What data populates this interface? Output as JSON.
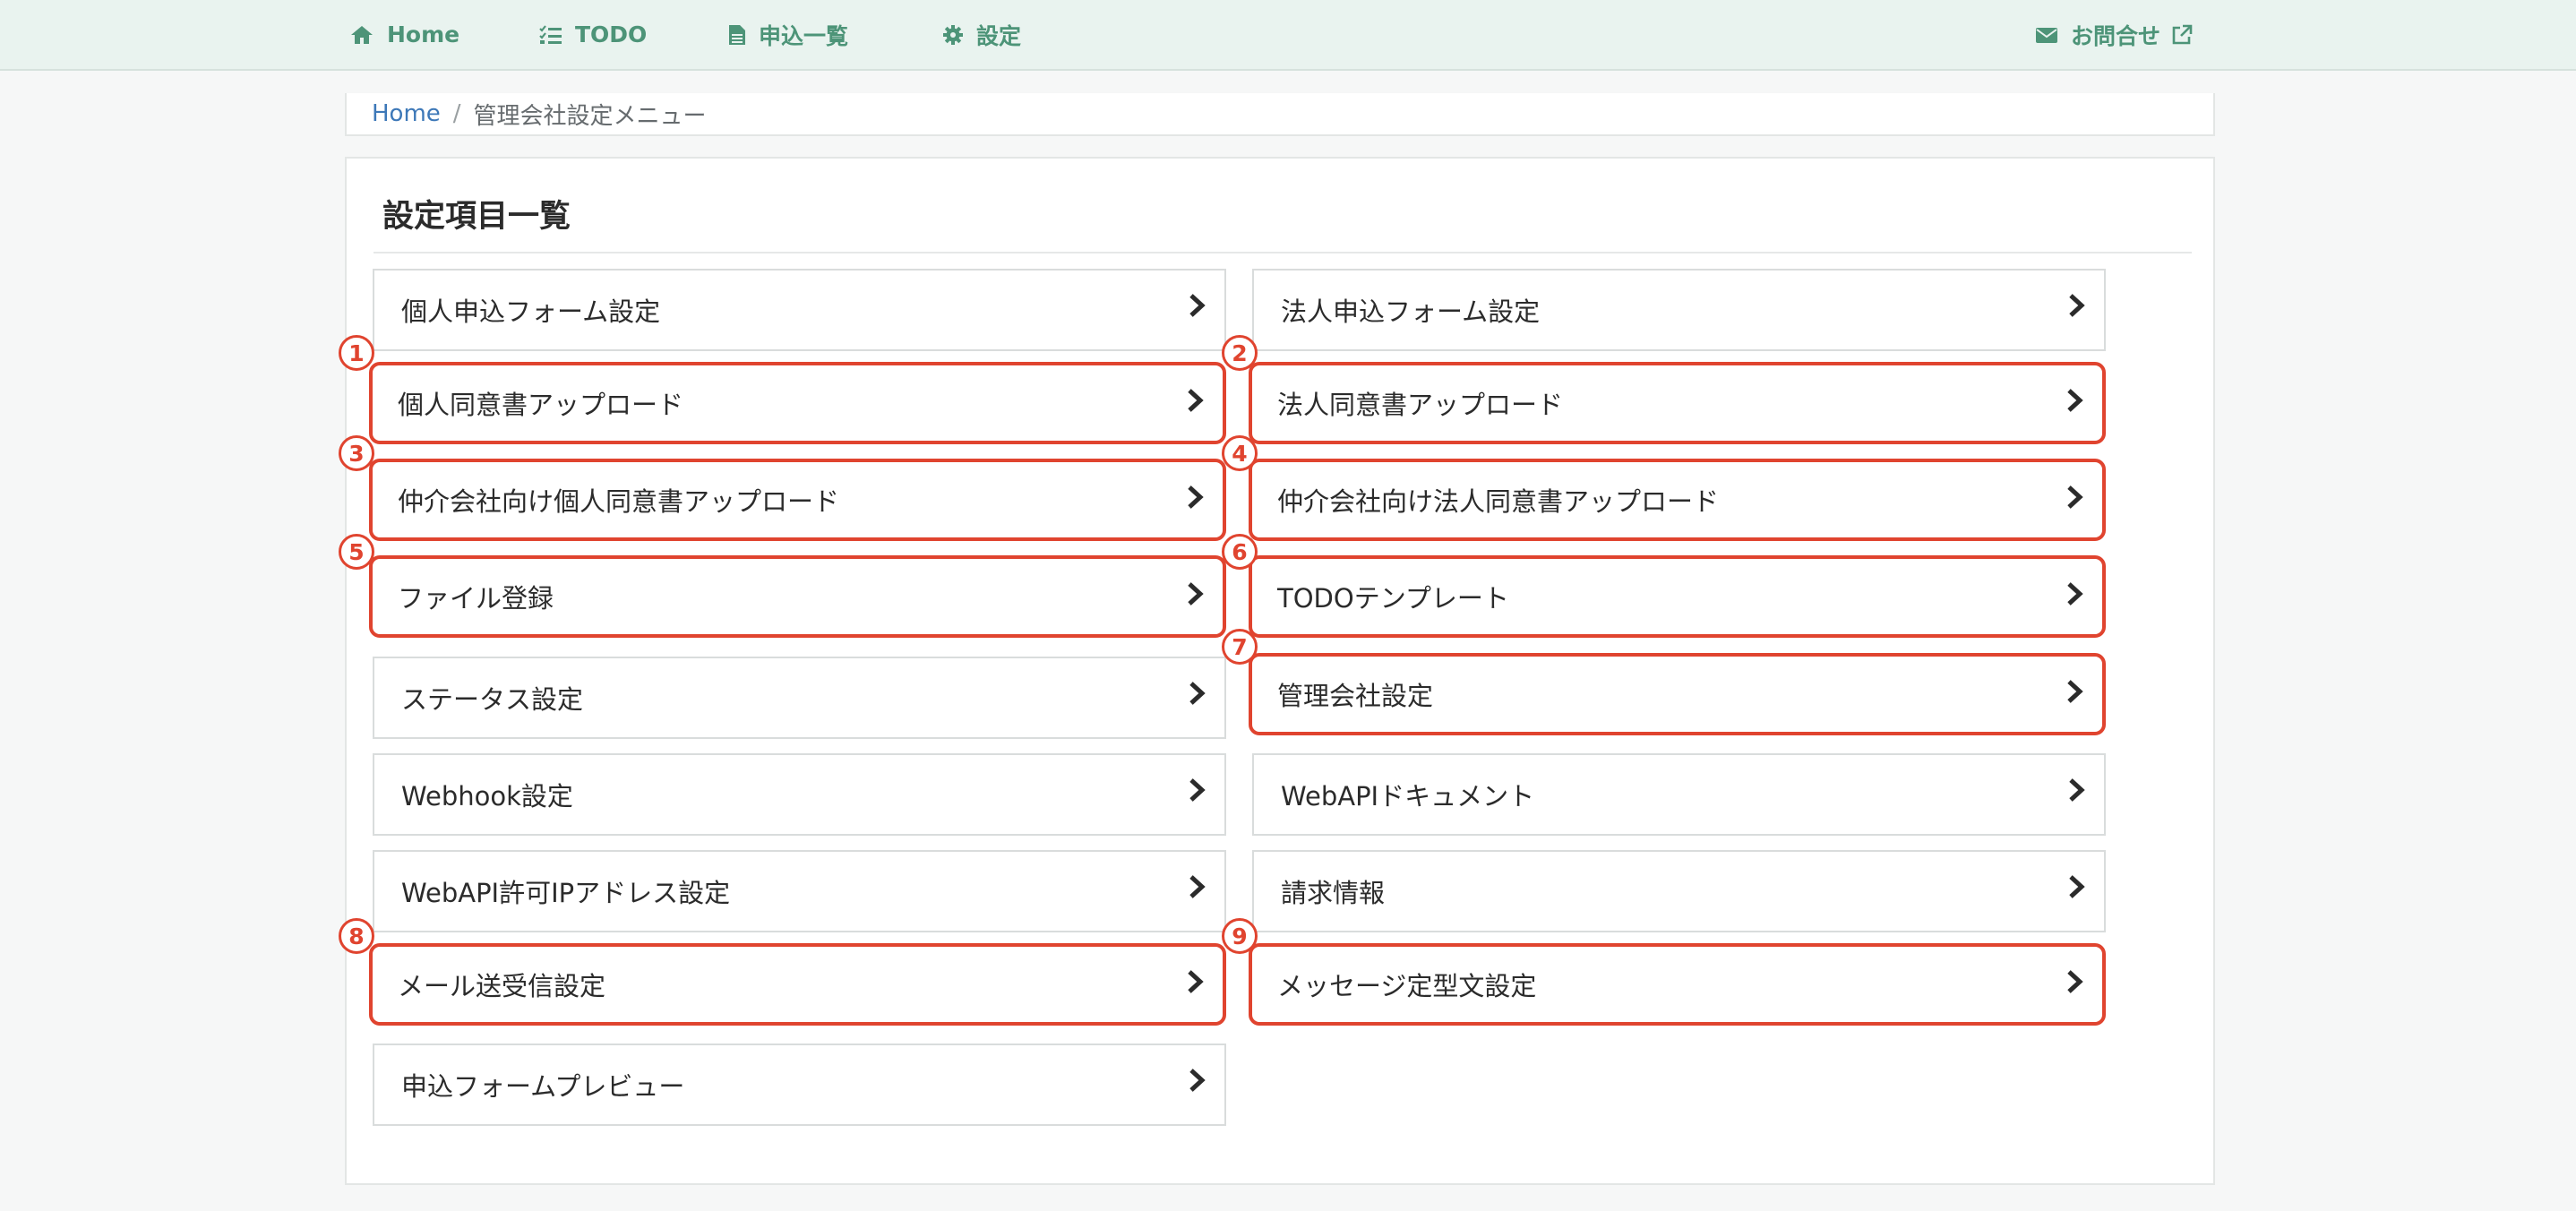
{
  "nav": {
    "home": "Home",
    "todo": "TODO",
    "applications": "申込一覧",
    "settings": "設定",
    "contact": "お問合せ",
    "icons": [
      "home-icon",
      "checklist-icon",
      "document-icon",
      "gear-icon",
      "envelope-icon",
      "external-link-icon"
    ]
  },
  "breadcrumb": {
    "home": "Home",
    "separator": "/",
    "current": "管理会社設定メニュー"
  },
  "panel": {
    "title": "設定項目一覧"
  },
  "items": {
    "l0": "個人申込フォーム設定",
    "r0": "法人申込フォーム設定",
    "l1": "個人同意書アップロード",
    "r1": "法人同意書アップロード",
    "l2": "仲介会社向け個人同意書アップロード",
    "r2": "仲介会社向け法人同意書アップロード",
    "l3": "ファイル登録",
    "r3": "TODOテンプレート",
    "l4": "ステータス設定",
    "r4": "管理会社設定",
    "l5": "Webhook設定",
    "r5": "WebAPIドキュメント",
    "l6": "WebAPI許可IPアドレス設定",
    "r6": "請求情報",
    "l7": "メール送受信設定",
    "r7": "メッセージ定型文設定",
    "l8": "申込フォームプレビュー"
  },
  "badges": {
    "b1": "1",
    "b2": "2",
    "b3": "3",
    "b4": "4",
    "b5": "5",
    "b6": "6",
    "b7": "7",
    "b8": "8",
    "b9": "9"
  },
  "colors": {
    "nav_bg": "#e9f3ef",
    "nav_text": "#4d9478",
    "highlight": "#e0442f",
    "link": "#3d78b8"
  }
}
